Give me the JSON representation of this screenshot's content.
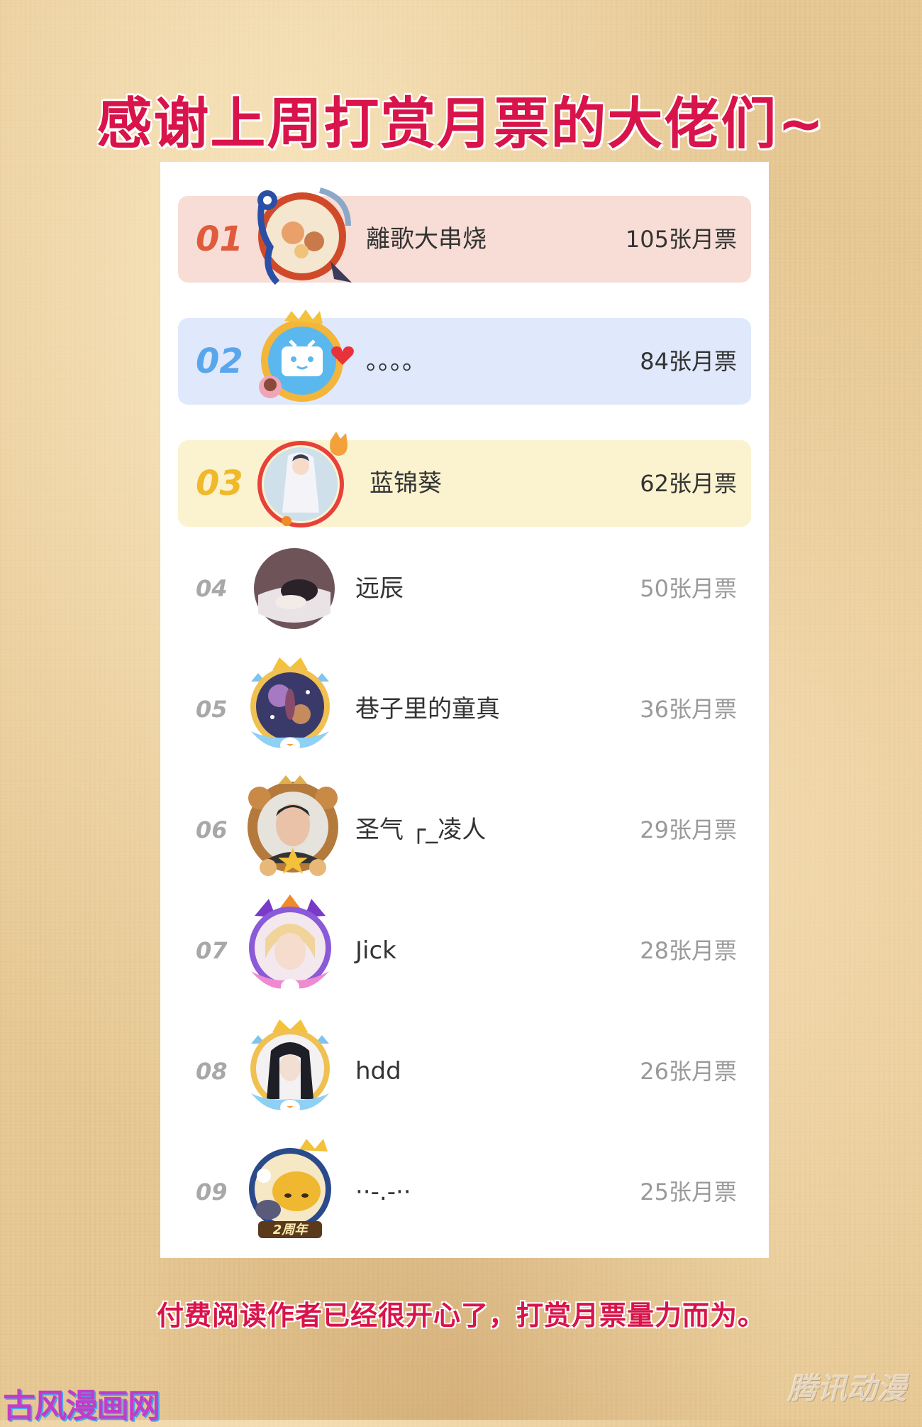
{
  "title": "感谢上周打赏月票的大佬们~",
  "footer": "付费阅读作者已经很开心了，打赏月票量力而为。",
  "watermark_left": "古风漫画网",
  "watermark_right": "腾讯动漫",
  "colors": {
    "accent": "#d8144a",
    "rank1_bg": "#f7ddd5",
    "rank2_bg": "#dfe9fb",
    "rank3_bg": "#fbf3d0",
    "rank1_num": "#e05a3c",
    "rank2_num": "#5aa6ec",
    "rank3_num": "#f0b92c"
  },
  "leaderboard": [
    {
      "rank": "01",
      "name": "離歌大串烧",
      "count": "105张月票",
      "avatar": "ornate-frame-avatar-icon"
    },
    {
      "rank": "02",
      "name": "。。。。",
      "count": "84张月票",
      "avatar": "bilibili-tv-avatar-icon"
    },
    {
      "rank": "03",
      "name": "蓝锦葵",
      "count": "62张月票",
      "avatar": "anime-girl-avatar-icon"
    },
    {
      "rank": "04",
      "name": "远辰",
      "count": "50张月票",
      "avatar": "sleeping-person-avatar-icon"
    },
    {
      "rank": "05",
      "name": "巷子里的童真",
      "count": "36张月票",
      "avatar": "galaxy-crown-avatar-icon"
    },
    {
      "rank": "06",
      "name": "圣气 ┌_凌人",
      "count": "29张月票",
      "avatar": "lion-frame-avatar-icon"
    },
    {
      "rank": "07",
      "name": "Jick",
      "count": "28张月票",
      "avatar": "anime-boy-avatar-icon"
    },
    {
      "rank": "08",
      "name": "hdd",
      "count": "26张月票",
      "avatar": "long-hair-avatar-icon"
    },
    {
      "rank": "09",
      "name": "··-.-··",
      "count": "25张月票",
      "avatar": "anniversary-avatar-icon",
      "badge": "2周年"
    }
  ]
}
